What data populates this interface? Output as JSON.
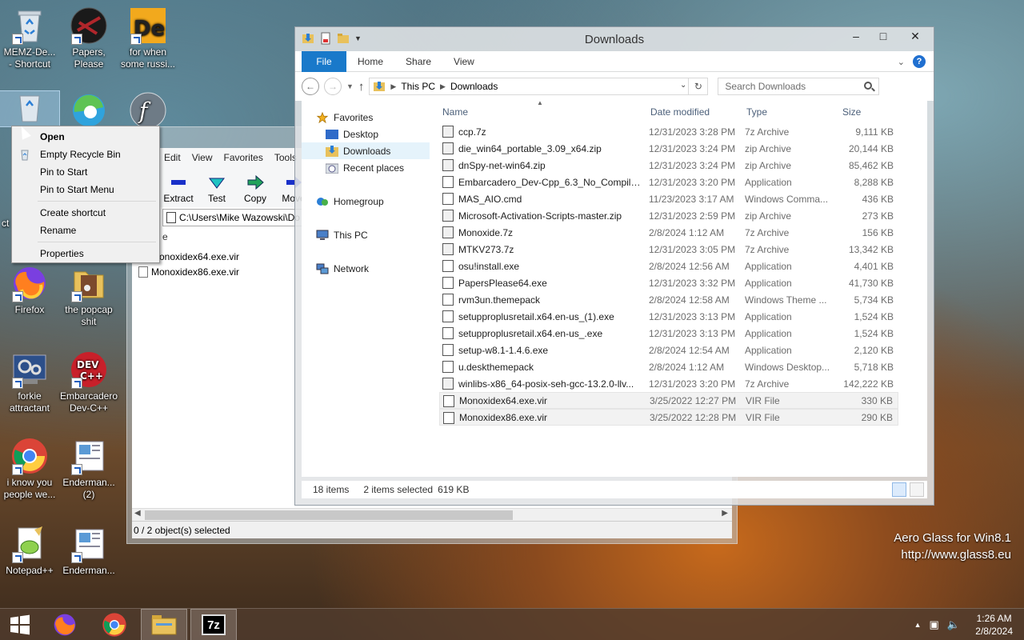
{
  "desktop": {
    "icons": [
      {
        "label": "MEMZ-De...\n- Shortcut"
      },
      {
        "label": "Papers,\nPlease"
      },
      {
        "label": "for when\nsome russi..."
      },
      {
        "label": "Firefox"
      },
      {
        "label": "the popcap\nshit"
      },
      {
        "label": "forkie\nattractant"
      },
      {
        "label": "Embarcadero\nDev-C++"
      },
      {
        "label": "i know you\npeople we..."
      },
      {
        "label": "Enderman...\n(2)"
      },
      {
        "label": "Notepad++"
      },
      {
        "label": "Enderman..."
      }
    ],
    "partial_labels": {
      "recycle": "M",
      "recycle2": "u",
      "cut_left": "ct"
    }
  },
  "context_menu": {
    "items": [
      "Open",
      "Empty Recycle Bin",
      "Pin to Start",
      "Pin to Start Menu",
      "Create shortcut",
      "Rename",
      "Properties"
    ]
  },
  "zip_window": {
    "menu": [
      "Edit",
      "View",
      "Favorites",
      "Tools"
    ],
    "tools": [
      "Extract",
      "Test",
      "Copy",
      "Move"
    ],
    "path": "C:\\Users\\Mike Wazowski\\Do",
    "col_partial": "e",
    "files": [
      "Monoxidex64.exe.vir",
      "Monoxidex86.exe.vir"
    ],
    "status": "0 / 2 object(s) selected"
  },
  "explorer": {
    "title": "Downloads",
    "ribbon_tabs": {
      "file": "File",
      "home": "Home",
      "share": "Share",
      "view": "View"
    },
    "breadcrumb": [
      "This PC",
      "Downloads"
    ],
    "search_placeholder": "Search Downloads",
    "nav": {
      "favorites": "Favorites",
      "desktop": "Desktop",
      "downloads": "Downloads",
      "recent": "Recent places",
      "homegroup": "Homegroup",
      "thispc": "This PC",
      "network": "Network"
    },
    "columns": {
      "name": "Name",
      "date": "Date modified",
      "type": "Type",
      "size": "Size"
    },
    "files": [
      {
        "name": "ccp.7z",
        "date": "12/31/2023 3:28 PM",
        "type": "7z Archive",
        "size": "9,111 KB"
      },
      {
        "name": "die_win64_portable_3.09_x64.zip",
        "date": "12/31/2023 3:24 PM",
        "type": "zip Archive",
        "size": "20,144 KB"
      },
      {
        "name": "dnSpy-net-win64.zip",
        "date": "12/31/2023 3:24 PM",
        "type": "zip Archive",
        "size": "85,462 KB"
      },
      {
        "name": "Embarcadero_Dev-Cpp_6.3_No_Compiler...",
        "date": "12/31/2023 3:20 PM",
        "type": "Application",
        "size": "8,288 KB"
      },
      {
        "name": "MAS_AIO.cmd",
        "date": "11/23/2023 3:17 AM",
        "type": "Windows Comma...",
        "size": "436 KB"
      },
      {
        "name": "Microsoft-Activation-Scripts-master.zip",
        "date": "12/31/2023 2:59 PM",
        "type": "zip Archive",
        "size": "273 KB"
      },
      {
        "name": "Monoxide.7z",
        "date": "2/8/2024 1:12 AM",
        "type": "7z Archive",
        "size": "156 KB"
      },
      {
        "name": "MTKV273.7z",
        "date": "12/31/2023 3:05 PM",
        "type": "7z Archive",
        "size": "13,342 KB"
      },
      {
        "name": "osu!install.exe",
        "date": "2/8/2024 12:56 AM",
        "type": "Application",
        "size": "4,401 KB"
      },
      {
        "name": "PapersPlease64.exe",
        "date": "12/31/2023 3:32 PM",
        "type": "Application",
        "size": "41,730 KB"
      },
      {
        "name": "rvm3un.themepack",
        "date": "2/8/2024 12:58 AM",
        "type": "Windows Theme ...",
        "size": "5,734 KB"
      },
      {
        "name": "setupproplusretail.x64.en-us_(1).exe",
        "date": "12/31/2023 3:13 PM",
        "type": "Application",
        "size": "1,524 KB"
      },
      {
        "name": "setupproplusretail.x64.en-us_.exe",
        "date": "12/31/2023 3:13 PM",
        "type": "Application",
        "size": "1,524 KB"
      },
      {
        "name": "setup-w8.1-1.4.6.exe",
        "date": "2/8/2024 12:54 AM",
        "type": "Application",
        "size": "2,120 KB"
      },
      {
        "name": "u.deskthemepack",
        "date": "2/8/2024 1:12 AM",
        "type": "Windows Desktop...",
        "size": "5,718 KB"
      },
      {
        "name": "winlibs-x86_64-posix-seh-gcc-13.2.0-llv...",
        "date": "12/31/2023 3:20 PM",
        "type": "7z Archive",
        "size": "142,222 KB"
      },
      {
        "name": "Monoxidex64.exe.vir",
        "date": "3/25/2022 12:27 PM",
        "type": "VIR File",
        "size": "330 KB"
      },
      {
        "name": "Monoxidex86.exe.vir",
        "date": "3/25/2022 12:28 PM",
        "type": "VIR File",
        "size": "290 KB"
      }
    ],
    "status": {
      "count": "18 items",
      "selected": "2 items selected",
      "size": "619 KB"
    }
  },
  "watermark": {
    "line1": "Aero Glass for Win8.1",
    "line2": "http://www.glass8.eu"
  },
  "clock": {
    "time": "1:26 AM",
    "date": "2/8/2024"
  },
  "taskbar": {
    "zip_label": "7z"
  }
}
